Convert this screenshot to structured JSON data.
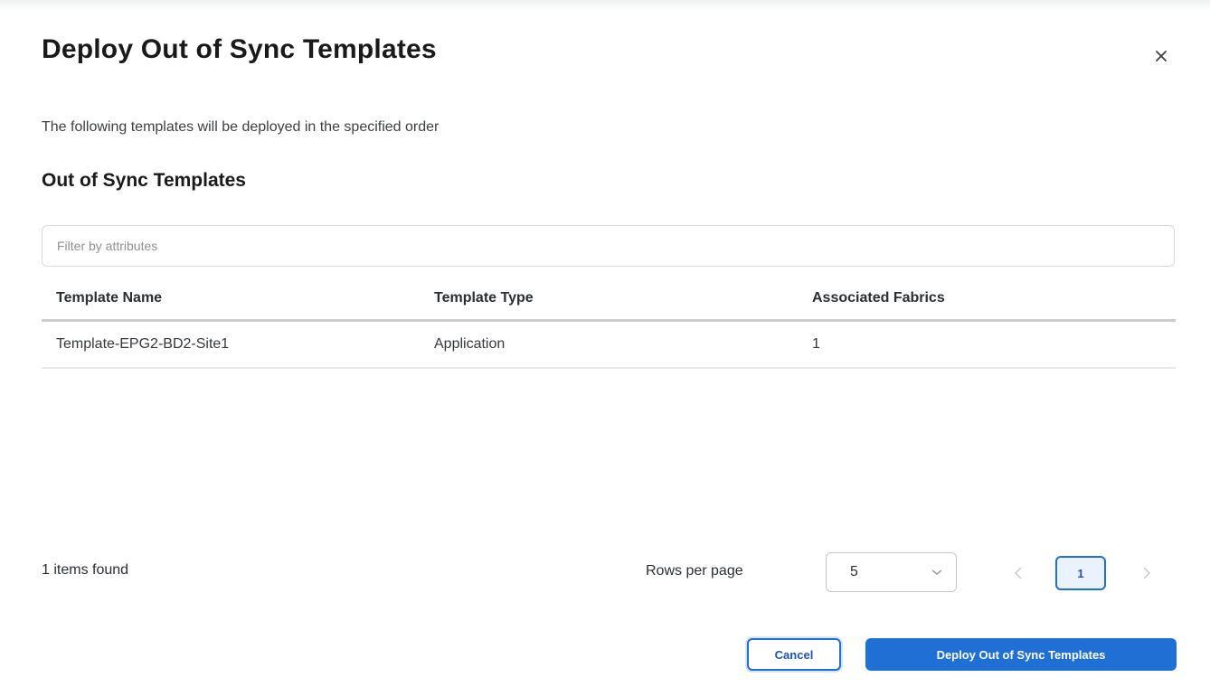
{
  "dialog": {
    "title": "Deploy Out of Sync Templates",
    "subtitle": "The following templates will be deployed in the specified order",
    "section_title": "Out of Sync Templates",
    "close_icon": "close-icon"
  },
  "filter": {
    "placeholder": "Filter by attributes",
    "value": ""
  },
  "table": {
    "columns": [
      "Template Name",
      "Template Type",
      "Associated Fabrics"
    ],
    "rows": [
      {
        "name": "Template-EPG2-BD2-Site1",
        "type": "Application",
        "fabrics": "1"
      }
    ]
  },
  "footer": {
    "items_found": "1 items found",
    "rows_per_page_label": "Rows per page",
    "rows_per_page_value": "5",
    "current_page": "1"
  },
  "actions": {
    "cancel_label": "Cancel",
    "deploy_label": "Deploy Out of Sync Templates"
  },
  "colors": {
    "accent": "#1f6fd4",
    "text": "#1a1a1a"
  }
}
